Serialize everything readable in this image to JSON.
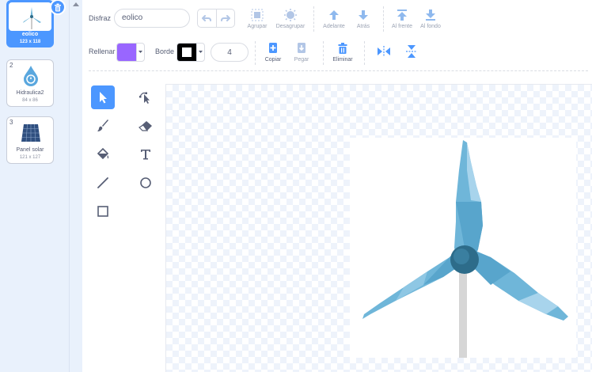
{
  "costumes": [
    {
      "number": "1",
      "name": "eolico",
      "size": "123 x 118",
      "selected": true
    },
    {
      "number": "2",
      "name": "Hidraulica2",
      "size": "84 x 86",
      "selected": false
    },
    {
      "number": "3",
      "name": "Panel solar",
      "size": "121 x 127",
      "selected": false
    }
  ],
  "toolbar": {
    "costume_label": "Disfraz",
    "costume_name": "eolico",
    "group": "Agrupar",
    "ungroup": "Desagrupar",
    "forward": "Adelante",
    "backward": "Atrás",
    "front": "Al frente",
    "back": "Al fondo",
    "fill_label": "Rellenar",
    "outline_label": "Borde",
    "outline_width": "4",
    "copy": "Copiar",
    "paste": "Pegar",
    "delete": "Eliminar"
  },
  "colors": {
    "fill": "#9966ff",
    "outline": "#000000",
    "accent": "#4c97ff"
  },
  "icons": [
    "undo-icon",
    "redo-icon",
    "select-icon",
    "reshape-icon",
    "brush-icon",
    "eraser-icon",
    "fill-icon",
    "text-icon",
    "line-icon",
    "circle-icon",
    "rect-icon",
    "flip-horizontal-icon",
    "flip-vertical-icon",
    "trash-icon"
  ]
}
